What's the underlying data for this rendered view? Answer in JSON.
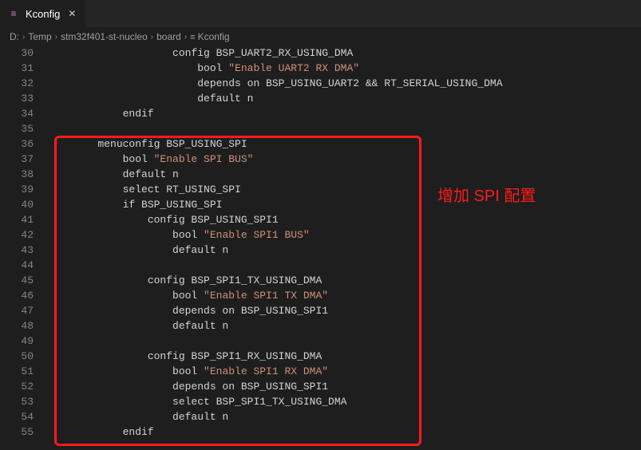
{
  "tab": {
    "title": "Kconfig"
  },
  "breadcrumb": [
    "D:",
    "Temp",
    "stm32f401-st-nucleo",
    "board",
    "Kconfig"
  ],
  "annotation": {
    "label": "增加 SPI 配置"
  },
  "first_line_number": 30,
  "lines": [
    {
      "indent": 5,
      "segs": [
        {
          "t": "config BSP_UART2_RX_USING_DMA"
        }
      ]
    },
    {
      "indent": 6,
      "segs": [
        {
          "t": "bool "
        },
        {
          "t": "\"Enable UART2 RX DMA\"",
          "c": "s"
        }
      ]
    },
    {
      "indent": 6,
      "segs": [
        {
          "t": "depends on BSP_USING_UART2 && RT_SERIAL_USING_DMA"
        }
      ]
    },
    {
      "indent": 6,
      "segs": [
        {
          "t": "default n"
        }
      ]
    },
    {
      "indent": 3,
      "segs": [
        {
          "t": "endif"
        }
      ]
    },
    {
      "indent": 0,
      "segs": []
    },
    {
      "indent": 2,
      "segs": [
        {
          "t": "menuconfig BSP_USING_SPI"
        }
      ]
    },
    {
      "indent": 3,
      "segs": [
        {
          "t": "bool "
        },
        {
          "t": "\"Enable SPI BUS\"",
          "c": "s"
        }
      ]
    },
    {
      "indent": 3,
      "segs": [
        {
          "t": "default n"
        }
      ]
    },
    {
      "indent": 3,
      "segs": [
        {
          "t": "select RT_USING_SPI"
        }
      ]
    },
    {
      "indent": 3,
      "segs": [
        {
          "t": "if BSP_USING_SPI"
        }
      ]
    },
    {
      "indent": 4,
      "segs": [
        {
          "t": "config BSP_USING_SPI1"
        }
      ]
    },
    {
      "indent": 5,
      "segs": [
        {
          "t": "bool "
        },
        {
          "t": "\"Enable SPI1 BUS\"",
          "c": "s"
        }
      ]
    },
    {
      "indent": 5,
      "segs": [
        {
          "t": "default n"
        }
      ]
    },
    {
      "indent": 0,
      "segs": []
    },
    {
      "indent": 4,
      "segs": [
        {
          "t": "config BSP_SPI1_TX_USING_DMA"
        }
      ]
    },
    {
      "indent": 5,
      "segs": [
        {
          "t": "bool "
        },
        {
          "t": "\"Enable SPI1 TX DMA\"",
          "c": "s"
        }
      ]
    },
    {
      "indent": 5,
      "segs": [
        {
          "t": "depends on BSP_USING_SPI1"
        }
      ]
    },
    {
      "indent": 5,
      "segs": [
        {
          "t": "default n"
        }
      ]
    },
    {
      "indent": 0,
      "segs": []
    },
    {
      "indent": 4,
      "segs": [
        {
          "t": "config BSP_SPI1_RX_USING_DMA"
        }
      ]
    },
    {
      "indent": 5,
      "segs": [
        {
          "t": "bool "
        },
        {
          "t": "\"Enable SPI1 RX DMA\"",
          "c": "s"
        }
      ]
    },
    {
      "indent": 5,
      "segs": [
        {
          "t": "depends on BSP_USING_SPI1"
        }
      ]
    },
    {
      "indent": 5,
      "segs": [
        {
          "t": "select BSP_SPI1_TX_USING_DMA"
        }
      ]
    },
    {
      "indent": 5,
      "segs": [
        {
          "t": "default n"
        }
      ]
    },
    {
      "indent": 3,
      "segs": [
        {
          "t": "endif"
        }
      ]
    }
  ]
}
